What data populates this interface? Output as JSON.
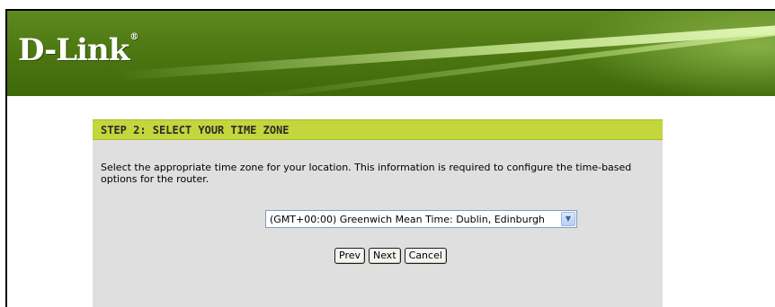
{
  "header": {
    "logo_text": "D-Link",
    "logo_mark": "®",
    "colors": {
      "banner": "#4a7510",
      "accent": "#c3d63c"
    }
  },
  "step": {
    "title": "STEP 2: SELECT YOUR TIME ZONE",
    "description": "Select the appropriate time zone for your location. This information is required to configure the time-based options for the router.",
    "timezone_select": {
      "selected": "(GMT+00:00) Greenwich Mean Time: Dublin, Edinburgh",
      "icon": "chevron-down-icon"
    },
    "buttons": {
      "prev": "Prev",
      "next": "Next",
      "cancel": "Cancel"
    }
  }
}
